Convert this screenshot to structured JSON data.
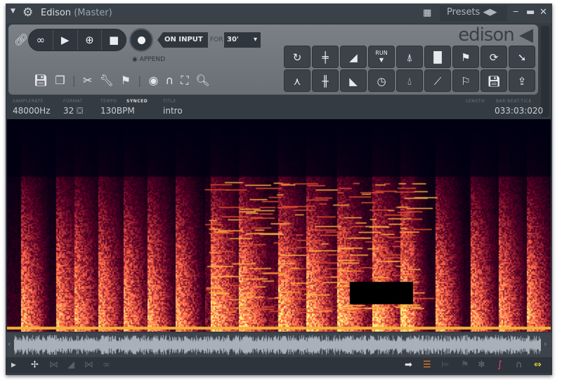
{
  "window": {
    "title": "Edison",
    "title_sub": "(Master)",
    "presets_label": "Presets"
  },
  "recorder": {
    "mode": "ON INPUT",
    "for_label": "FOR",
    "duration": "30'",
    "append_label": "APPEND",
    "logo": "edison"
  },
  "info": {
    "samplerate_label": "SAMPLERATE",
    "samplerate": "48000Hz",
    "format_label": "FORMAT",
    "format": "32",
    "tempo_label": "TEMPO",
    "synced_label": "SYNCED",
    "tempo": "130BPM",
    "title_label": "TITLE",
    "title": "intro",
    "length_label": "LENGTH",
    "position_label": "BAR:BEAT:TICK",
    "position": "033:03:020"
  },
  "toolgrid": {
    "run_label": "RUN"
  },
  "colors": {
    "accent_orange": "#f07b2a",
    "accent_pink": "#e8467c",
    "accent_yellow": "#f2e23a",
    "panel": "#70757c",
    "background": "#343b43"
  }
}
